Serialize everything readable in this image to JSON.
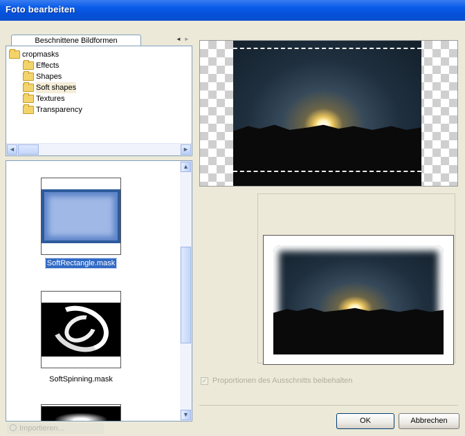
{
  "window": {
    "title": "Foto bearbeiten"
  },
  "tab": {
    "label": "Beschnittene Bildformen",
    "prev_arrow": "◄",
    "next_arrow": "►"
  },
  "tree": {
    "root": "cropmasks",
    "items": [
      "Effects",
      "Shapes",
      "Soft shapes",
      "Textures",
      "Transparency"
    ],
    "selected": "Soft shapes"
  },
  "masks": [
    {
      "label": "SoftRectangle.mask",
      "selected": true
    },
    {
      "label": "SoftSpinning.mask",
      "selected": false
    }
  ],
  "bottom_left_button": {
    "label": "Importieren..."
  },
  "options": {
    "keep_proportions_label": "Proportionen des Ausschnitts beibehalten",
    "keep_proportions_checked": true
  },
  "buttons": {
    "ok": "OK",
    "cancel": "Abbrechen"
  },
  "colors": {
    "titlebar": "#0a5ce8",
    "selection": "#316ac5",
    "dialog_bg": "#ece9d8",
    "button_border": "#003c74"
  },
  "icons": [
    "folder-icon",
    "chevron-left-icon",
    "chevron-right-icon",
    "chevron-up-icon",
    "chevron-down-icon",
    "import-icon",
    "checkbox-icon"
  ]
}
